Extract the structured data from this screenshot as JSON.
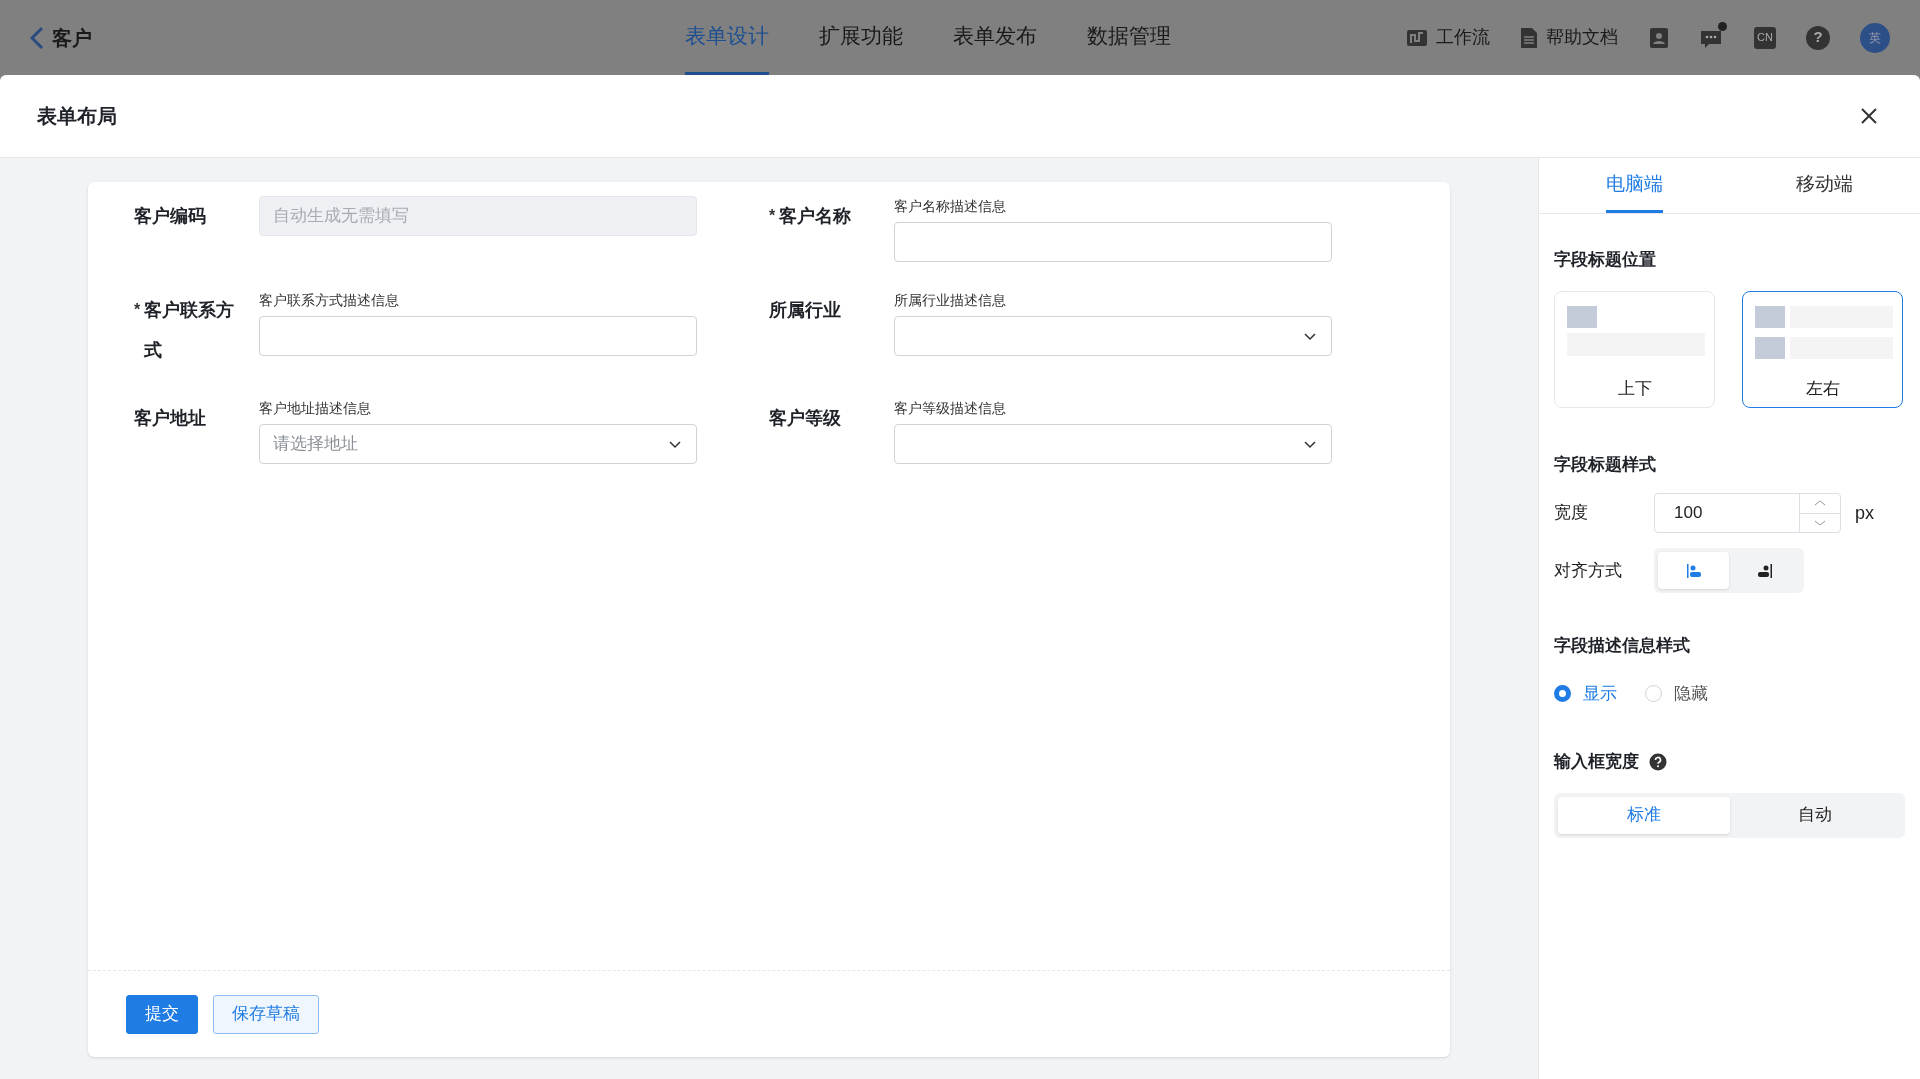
{
  "top_bar": {
    "back_label": "客户",
    "tabs": [
      {
        "label": "表单设计",
        "selected": true
      },
      {
        "label": "扩展功能",
        "selected": false
      },
      {
        "label": "表单发布",
        "selected": false
      },
      {
        "label": "数据管理",
        "selected": false
      }
    ],
    "tools": [
      {
        "kind": "workflow",
        "label": "工作流"
      },
      {
        "kind": "document",
        "label": "帮助文档"
      }
    ],
    "icons": [
      {
        "kind": "contacts"
      },
      {
        "kind": "chat",
        "unread": true
      },
      {
        "kind": "language",
        "text": "CN"
      },
      {
        "kind": "help",
        "text": "?"
      },
      {
        "kind": "avatar",
        "text": "英"
      }
    ]
  },
  "dialog": {
    "title": "表单布局",
    "form": {
      "fields": [
        {
          "label": "客户编码",
          "kind": "text",
          "placeholder": "自动生成无需填写",
          "disabled": true
        },
        {
          "required_mark": "*",
          "label": "客户名称",
          "description": "客户名称描述信息",
          "kind": "text",
          "disabled": false
        },
        {
          "required_mark": "*",
          "label": "客户联系方式",
          "description": "客户联系方式描述信息",
          "kind": "text",
          "disabled": false
        },
        {
          "label": "所属行业",
          "description": "所属行业描述信息",
          "kind": "select",
          "disabled": false
        },
        {
          "label": "客户地址",
          "description": "客户地址描述信息",
          "kind": "select",
          "placeholder": "请选择地址",
          "disabled": false
        },
        {
          "label": "客户等级",
          "description": "客户等级描述信息",
          "kind": "select",
          "disabled": false
        }
      ],
      "buttons": [
        {
          "label": "提交",
          "kind": "primary"
        },
        {
          "label": "保存草稿",
          "kind": "secondary"
        }
      ]
    },
    "settings": {
      "tabs": [
        {
          "label": "电脑端",
          "selected": true
        },
        {
          "label": "移动端",
          "selected": false
        }
      ],
      "title_position": {
        "heading": "字段标题位置",
        "options": [
          {
            "label": "上下",
            "kind": "stacked",
            "selected": false
          },
          {
            "label": "左右",
            "kind": "side",
            "selected": true
          }
        ]
      },
      "title_style": {
        "heading": "字段标题样式",
        "width_label": "宽度",
        "width_value": "100",
        "width_unit": "px",
        "align_label": "对齐方式",
        "align_options": [
          {
            "kind": "left",
            "selected": true
          },
          {
            "kind": "right",
            "selected": false
          }
        ]
      },
      "description_style": {
        "heading": "字段描述信息样式",
        "options": [
          {
            "label": "显示",
            "selected": true
          },
          {
            "label": "隐藏",
            "selected": false
          }
        ]
      },
      "input_width": {
        "heading": "输入框宽度",
        "options": [
          {
            "label": "标准",
            "selected": true
          },
          {
            "label": "自动",
            "selected": false
          }
        ]
      }
    }
  }
}
